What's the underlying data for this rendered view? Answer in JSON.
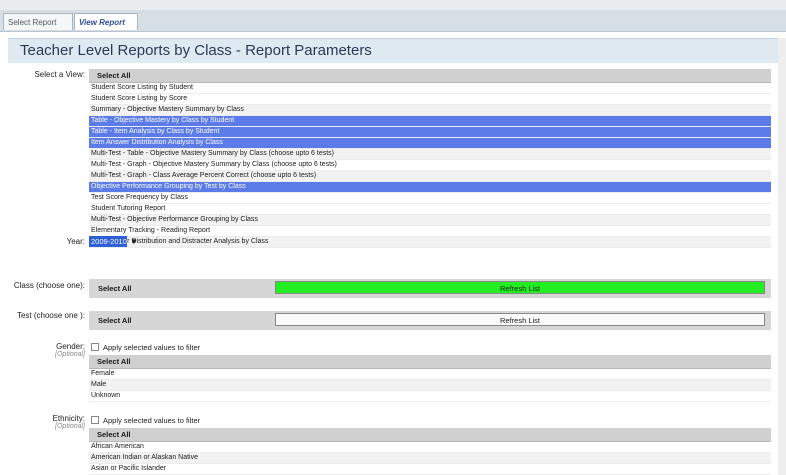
{
  "tabs": {
    "select_report": "Select Report",
    "view_report": "View Report"
  },
  "title": "Teacher Level Reports by Class - Report Parameters",
  "view": {
    "label": "Select a View:",
    "header": "Select All",
    "items": [
      "Student Score Listing by Student",
      "Student Score Listing by Score",
      "Summary - Objective Mastery Summary by Class",
      "Table - Objective Mastery by Class by Student",
      "Table - Item Analysis by Class by Student",
      "Item Answer Distribution Analysis by Class",
      "Multi-Test - Table - Objective Mastery Summary by Class (choose upto 6 tests)",
      "Multi-Test - Graph - Objective Mastery Summary by Class (choose upto 6 tests)",
      "Multi-Test - Graph - Class Average Percent Correct (choose upto 6 tests)",
      "Objective Performance Grouping by Test by Class",
      "Test Score Frequency by Class",
      "Student Tutoring Report",
      "Multi-Test - Objective Performance Grouping by Class",
      "Elementary Tracking - Reading Report",
      "Item Answer Distribution and Distracter Analysis by Class"
    ]
  },
  "year": {
    "label": "Year:",
    "value": "2009-2010"
  },
  "class": {
    "label": "Class (choose one):",
    "select_all": "Select All",
    "refresh": "Refresh List"
  },
  "test": {
    "label": "Test (choose one ):",
    "select_all": "Select All",
    "refresh": "Refresh List"
  },
  "gender": {
    "label": "Gender:",
    "optional": "[Optional]",
    "filter_label": "Apply selected values to filter",
    "header": "Select All",
    "items": [
      "Female",
      "Male",
      "Unknown"
    ]
  },
  "ethnicity": {
    "label": "Ethnicity:",
    "optional": "[Optional]",
    "filter_label": "Apply selected values to filter",
    "header": "Select All",
    "items": [
      "African American",
      "American Indian or Alaskan Native",
      "Asian or Pacific Islander"
    ]
  }
}
